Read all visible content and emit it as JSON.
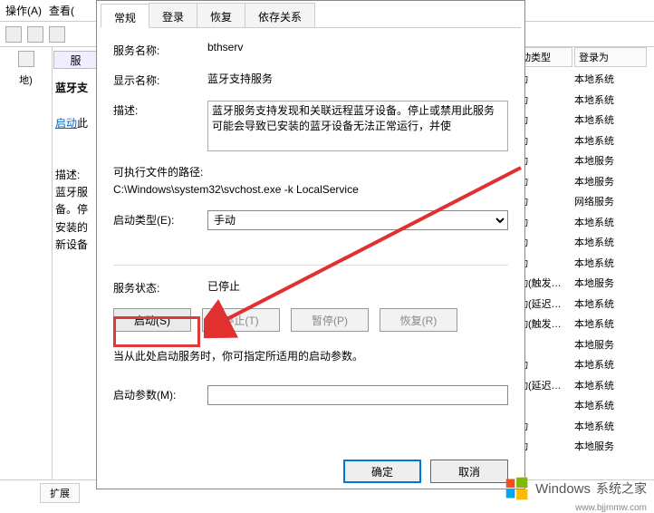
{
  "toolbar": {
    "action": "操作(A)",
    "view": "查看("
  },
  "leftpanel": {
    "label": "地)"
  },
  "midpanel": {
    "header": "服",
    "title": "蓝牙支",
    "link": "启动",
    "linkSuffix": "此",
    "descLines": [
      "描述:",
      "蓝牙服",
      "备。停",
      "安装的",
      "新设备"
    ]
  },
  "tabs": {
    "general": "常规",
    "logon": "登录",
    "recovery": "恢复",
    "dependency": "依存关系"
  },
  "labels": {
    "serviceName": "服务名称:",
    "displayName": "显示名称:",
    "description": "描述:",
    "exePathLabel": "可执行文件的路径:",
    "startupType": "启动类型(E):",
    "serviceStatus": "服务状态:",
    "startParams": "启动参数(M):"
  },
  "values": {
    "serviceName": "bthserv",
    "displayName": "蓝牙支持服务",
    "description": "蓝牙服务支持发现和关联远程蓝牙设备。停止或禁用此服务可能会导致已安装的蓝牙设备无法正常运行，并使",
    "exePath": "C:\\Windows\\system32\\svchost.exe -k LocalService",
    "startupType": "手动",
    "serviceStatus": "已停止"
  },
  "buttons": {
    "start": "启动(S)",
    "stop": "停止(T)",
    "pause": "暂停(P)",
    "resume": "恢复(R)",
    "ok": "确定",
    "cancel": "取消"
  },
  "hint": "当从此处启动服务时，你可指定所适用的启动参数。",
  "columns": {
    "startType": "动类型",
    "logonAs": "登录为"
  },
  "rows": [
    {
      "c1": "动",
      "c2": "本地系统"
    },
    {
      "c1": "动",
      "c2": "本地系统"
    },
    {
      "c1": "动",
      "c2": "本地系统"
    },
    {
      "c1": "动",
      "c2": "本地系统"
    },
    {
      "c1": "动",
      "c2": "本地服务"
    },
    {
      "c1": "动",
      "c2": "本地服务"
    },
    {
      "c1": "动",
      "c2": "网络服务"
    },
    {
      "c1": "动",
      "c2": "本地系统"
    },
    {
      "c1": "动",
      "c2": "本地系统"
    },
    {
      "c1": "动",
      "c2": "本地系统"
    },
    {
      "c1": "动(触发…",
      "c2": "本地服务"
    },
    {
      "c1": "动(延迟…",
      "c2": "本地系统"
    },
    {
      "c1": "动(触发…",
      "c2": "本地系统"
    },
    {
      "c1": "",
      "c2": "本地服务"
    },
    {
      "c1": "动",
      "c2": "本地系统"
    },
    {
      "c1": "动(延迟…",
      "c2": "本地系统"
    },
    {
      "c1": "",
      "c2": "本地系统"
    },
    {
      "c1": "动",
      "c2": "本地系统"
    },
    {
      "c1": "动",
      "c2": "本地服务"
    }
  ],
  "extTab": "扩展",
  "watermark": {
    "brand1": "Windows",
    "brand2": "系统之家",
    "url": "www.bjjmmw.com"
  }
}
